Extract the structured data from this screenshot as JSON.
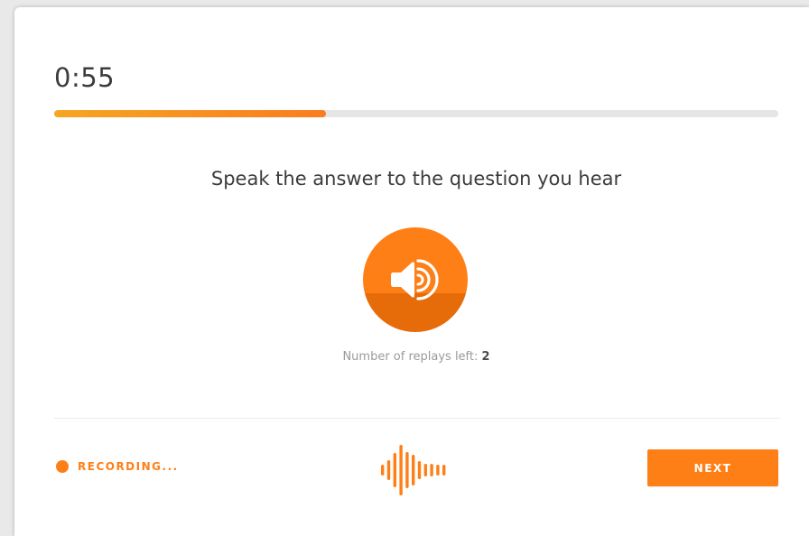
{
  "timer": {
    "value": "0:55"
  },
  "progress": {
    "fraction": 0.375,
    "color_start": "#f5a623",
    "color_end": "#fa7c1e"
  },
  "prompt": {
    "text": "Speak the answer to the question you hear"
  },
  "play_button": {
    "icon": "speaker-volume-icon",
    "color": "#ff7f17"
  },
  "replays": {
    "label": "Number of replays left: ",
    "count": "2"
  },
  "recording": {
    "label": "RECORDING...",
    "color": "#ff7f17"
  },
  "waveform": {
    "icon": "audio-waveform-icon"
  },
  "next_button": {
    "label": "NEXT",
    "color": "#ff7f17"
  }
}
